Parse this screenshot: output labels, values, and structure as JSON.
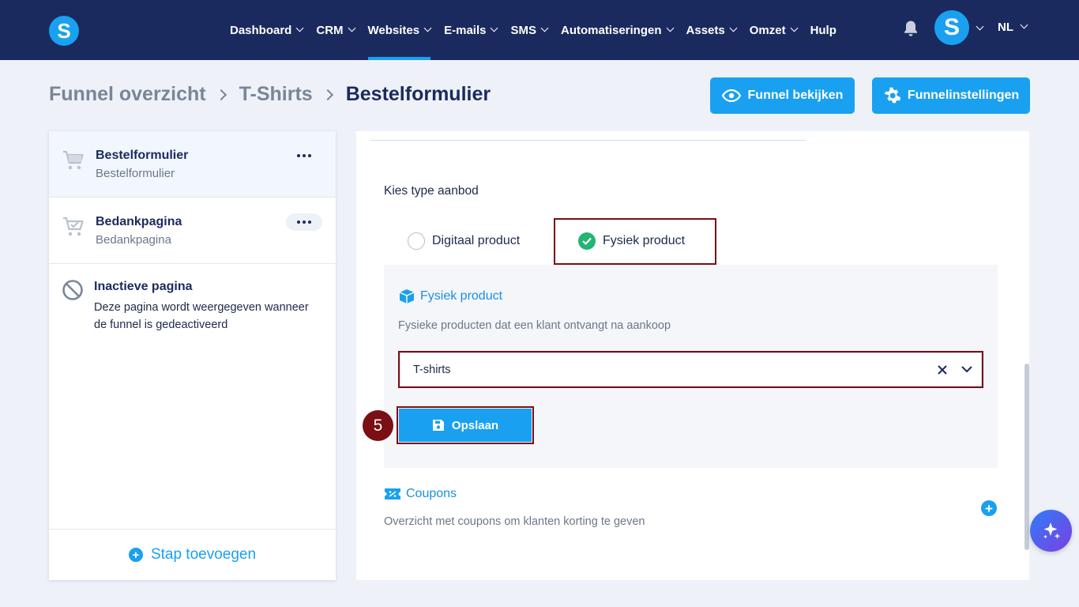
{
  "nav": {
    "logo": "S",
    "items": [
      {
        "label": "Dashboard",
        "active": false
      },
      {
        "label": "CRM",
        "active": false
      },
      {
        "label": "Websites",
        "active": true
      },
      {
        "label": "E-mails",
        "active": false
      },
      {
        "label": "SMS",
        "active": false
      },
      {
        "label": "Automatiseringen",
        "active": false
      },
      {
        "label": "Assets",
        "active": false
      },
      {
        "label": "Omzet",
        "active": false
      }
    ],
    "help": "Hulp",
    "avatar": "S",
    "language": "NL"
  },
  "breadcrumb": {
    "items": [
      "Funnel overzicht",
      "T-Shirts"
    ],
    "current": "Bestelformulier"
  },
  "actions": {
    "view_funnel": "Funnel bekijken",
    "funnel_settings": "Funnelinstellingen"
  },
  "steps": [
    {
      "title": "Bestelformulier",
      "subtitle": "Bestelformulier"
    },
    {
      "title": "Bedankpagina",
      "subtitle": "Bedankpagina"
    }
  ],
  "inactive": {
    "title": "Inactieve pagina",
    "text": "Deze pagina wordt weergegeven wanneer de funnel is gedeactiveerd"
  },
  "add_step": "Stap toevoegen",
  "offer": {
    "label": "Kies type aanbod",
    "options": [
      "Digitaal product",
      "Fysiek product"
    ],
    "selected": "Fysiek product"
  },
  "physical": {
    "title": "Fysiek product",
    "description": "Fysieke producten dat een klant ontvangt na aankoop",
    "selected_value": "T-shirts",
    "save": "Opslaan"
  },
  "step_marker": "5",
  "coupons": {
    "title": "Coupons",
    "description": "Overzicht met coupons om klanten korting te geven"
  },
  "colors": {
    "nav_bg": "#1b2a5e",
    "accent": "#1aa0f0",
    "highlight": "#7a0f14",
    "success": "#22b573"
  }
}
